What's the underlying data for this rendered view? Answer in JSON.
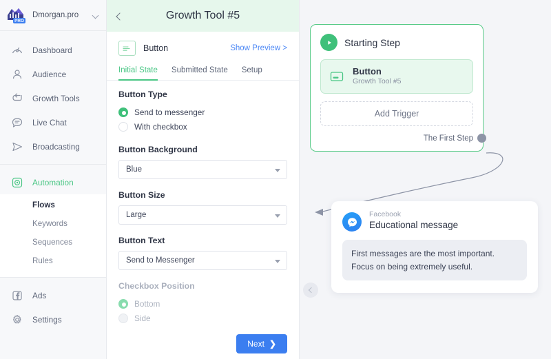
{
  "sidebar": {
    "brand": {
      "name": "Dmorgan.pro",
      "badge": "PRO",
      "chevron_icon": "chevron-down-icon"
    },
    "items": [
      {
        "label": "Dashboard",
        "icon": "gauge-icon"
      },
      {
        "label": "Audience",
        "icon": "person-icon"
      },
      {
        "label": "Growth Tools",
        "icon": "return-arrow-icon"
      },
      {
        "label": "Live Chat",
        "icon": "chat-bubble-icon"
      },
      {
        "label": "Broadcasting",
        "icon": "paper-plane-icon"
      }
    ],
    "automation": {
      "label": "Automation",
      "icon": "automation-atom-icon",
      "active": true
    },
    "sub_items": [
      {
        "label": "Flows",
        "current": true
      },
      {
        "label": "Keywords",
        "current": false
      },
      {
        "label": "Sequences",
        "current": false
      },
      {
        "label": "Rules",
        "current": false
      }
    ],
    "bottom_items": [
      {
        "label": "Ads",
        "icon": "facebook-square-icon"
      },
      {
        "label": "Settings",
        "icon": "gear-icon"
      }
    ]
  },
  "panel": {
    "back_icon": "chevron-left-icon",
    "title": "Growth Tool #5",
    "type_label": "Button",
    "type_icon": "button-widget-icon",
    "preview_link": "Show Preview >",
    "tabs": [
      {
        "label": "Initial State",
        "active": true
      },
      {
        "label": "Submitted State",
        "active": false
      },
      {
        "label": "Setup",
        "active": false
      }
    ],
    "button_type": {
      "label": "Button Type",
      "options": [
        {
          "label": "Send to messenger",
          "selected": true
        },
        {
          "label": "With checkbox",
          "selected": false
        }
      ]
    },
    "button_background": {
      "label": "Button Background",
      "value": "Blue"
    },
    "button_size": {
      "label": "Button Size",
      "value": "Large"
    },
    "button_text": {
      "label": "Button Text",
      "value": "Send to Messenger"
    },
    "checkbox_position": {
      "label": "Checkbox Position",
      "disabled": true,
      "options": [
        {
          "label": "Bottom",
          "selected": true
        },
        {
          "label": "Side",
          "selected": false
        }
      ]
    },
    "next_button": {
      "label": "Next",
      "arrow": "chevron-right-icon"
    }
  },
  "canvas": {
    "collapse_icon": "chevron-left-icon",
    "start_card": {
      "play_icon": "play-icon",
      "title": "Starting Step",
      "node": {
        "icon": "button-widget-icon",
        "title": "Button",
        "subtitle": "Growth Tool #5"
      },
      "add_trigger_label": "Add Trigger",
      "first_step_label": "The First Step",
      "connector_dot": "connection-handle"
    },
    "message_card": {
      "avatar_icon": "messenger-icon",
      "source": "Facebook",
      "title": "Educational message",
      "bubble_text": "First messages are the most important. Focus on being extremely useful."
    }
  },
  "colors": {
    "green": "#3fc07a",
    "green_light": "#e6f7ec",
    "blue": "#3b7ef0",
    "link_blue": "#4b87f5",
    "text_dark": "#2f3545",
    "text_muted": "#8a91a1",
    "canvas_bg": "#f4f5f8"
  }
}
